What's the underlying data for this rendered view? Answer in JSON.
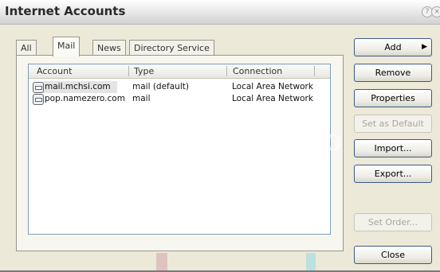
{
  "window": {
    "title": "Internet Accounts",
    "help_icon": "?",
    "close_icon": "×"
  },
  "tabs": [
    {
      "label": "All"
    },
    {
      "label": "Mail",
      "active": true
    },
    {
      "label": "News"
    },
    {
      "label": "Directory Service"
    }
  ],
  "list": {
    "columns": [
      "Account",
      "Type",
      "Connection"
    ],
    "rows": [
      {
        "account": "mail.mchsi.com",
        "type": "mail (default)",
        "connection": "Local Area Network",
        "selected": true
      },
      {
        "account": "pop.namezero.com",
        "type": "mail",
        "connection": "Local Area Network",
        "selected": false
      }
    ]
  },
  "buttons": {
    "add": "Add",
    "add_arrow": "▶",
    "remove": "Remove",
    "properties": "Properties",
    "set_as_default": "Set as Default",
    "import": "Import...",
    "export": "Export...",
    "set_order": "Set Order...",
    "close": "Close"
  },
  "watermark": {
    "text": "DropBo"
  },
  "colors": {
    "dialog_bg": "#ece9d8",
    "list_border": "#7f9db9",
    "button_border": "#3c5a88",
    "watermark_pink": "#d9b9bd",
    "watermark_cyan": "#a9dbe6"
  }
}
